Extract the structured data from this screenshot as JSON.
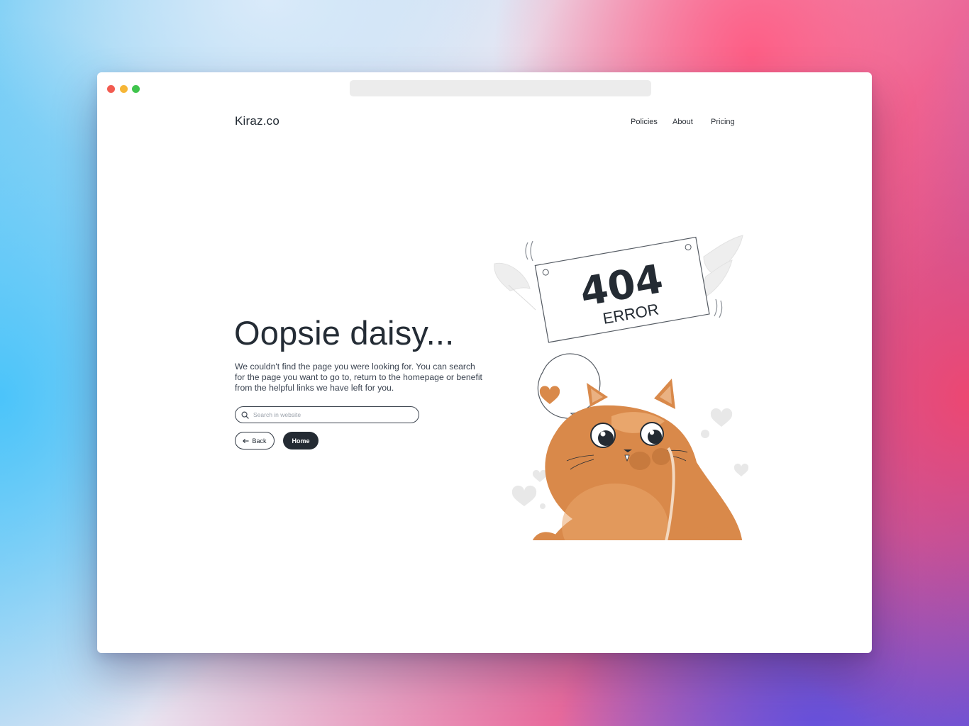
{
  "site": {
    "brand": "Kiraz.co"
  },
  "nav": {
    "items": [
      {
        "label": "Policies"
      },
      {
        "label": "About"
      },
      {
        "label": "Pricing"
      }
    ]
  },
  "hero": {
    "title": "Oopsie daisy...",
    "description": "We couldn't find the page you were looking for. You can search for the page you want to go to, return to the homepage or benefit from the helpful links we have left for you.",
    "search_placeholder": "Search in website",
    "search_value": "",
    "back_label": "Back",
    "home_label": "Home"
  },
  "illustration": {
    "sign_number": "404",
    "sign_text": "ERROR",
    "accent": "#d9894a"
  },
  "colors": {
    "accent": "#d9894a",
    "dark": "#242b33"
  }
}
